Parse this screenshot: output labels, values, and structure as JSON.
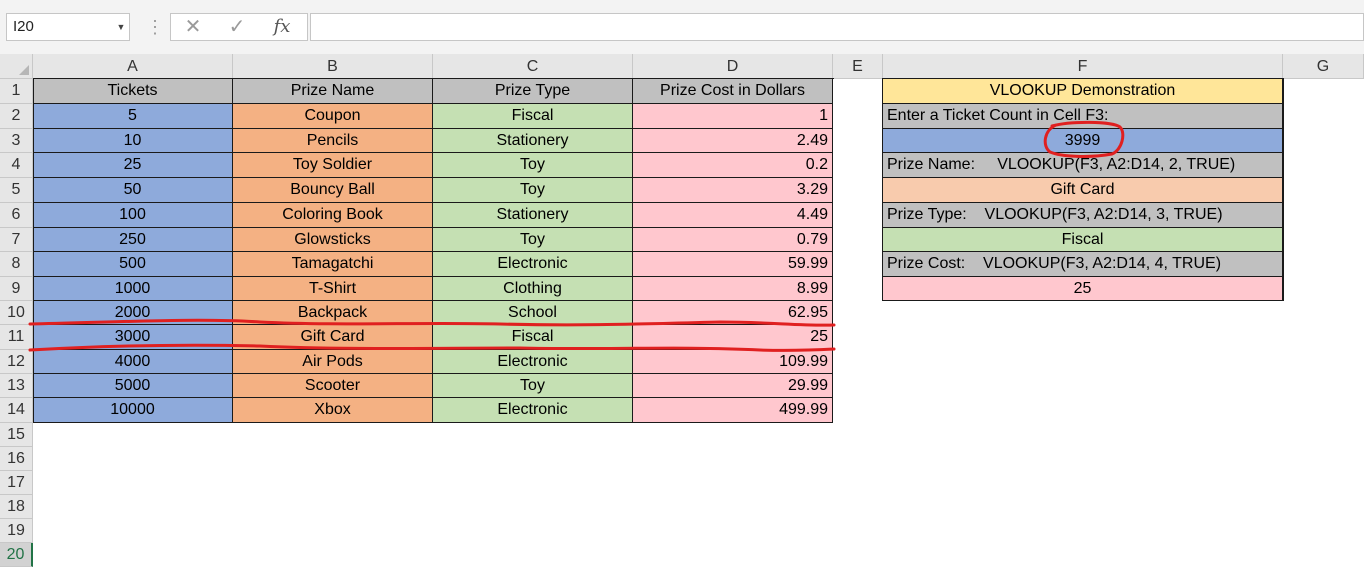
{
  "formula_bar": {
    "name_box": "I20",
    "cancel_icon": "✕",
    "enter_icon": "✓",
    "fx_label": "fx",
    "formula_value": ""
  },
  "colors": {
    "tickets": "#8eaadb",
    "prize_name": "#f4b183",
    "prize_type": "#c5e0b3",
    "prize_cost": "#ffc7ce",
    "header": "#c0c0c0",
    "demo_title": "#ffe699",
    "input_cell": "#8eaadb",
    "result_name": "#f8cbad",
    "annotation_red": "#e02020"
  },
  "columns": [
    "A",
    "B",
    "C",
    "D",
    "E",
    "F",
    "G"
  ],
  "rows": [
    "1",
    "2",
    "3",
    "4",
    "5",
    "6",
    "7",
    "8",
    "9",
    "10",
    "11",
    "12",
    "13",
    "14",
    "15",
    "16",
    "17",
    "18",
    "19",
    "20"
  ],
  "selected_row": "20",
  "table": {
    "headers": [
      "Tickets",
      "Prize Name",
      "Prize Type",
      "Prize Cost in Dollars"
    ],
    "rows": [
      [
        "5",
        "Coupon",
        "Fiscal",
        "1"
      ],
      [
        "10",
        "Pencils",
        "Stationery",
        "2.49"
      ],
      [
        "25",
        "Toy Soldier",
        "Toy",
        "0.2"
      ],
      [
        "50",
        "Bouncy Ball",
        "Toy",
        "3.29"
      ],
      [
        "100",
        "Coloring Book",
        "Stationery",
        "4.49"
      ],
      [
        "250",
        "Glowsticks",
        "Toy",
        "0.79"
      ],
      [
        "500",
        "Tamagatchi",
        "Electronic",
        "59.99"
      ],
      [
        "1000",
        "T-Shirt",
        "Clothing",
        "8.99"
      ],
      [
        "2000",
        "Backpack",
        "School",
        "62.95"
      ],
      [
        "3000",
        "Gift Card",
        "Fiscal",
        "25"
      ],
      [
        "4000",
        "Air Pods",
        "Electronic",
        "109.99"
      ],
      [
        "5000",
        "Scooter",
        "Toy",
        "29.99"
      ],
      [
        "10000",
        "Xbox",
        "Electronic",
        "499.99"
      ]
    ]
  },
  "demo": {
    "title": "VLOOKUP Demonstration",
    "prompt": "Enter a Ticket Count in Cell F3:",
    "input_value": "3999",
    "name_label": "Prize Name:     VLOOKUP(F3, A2:D14, 2, TRUE)",
    "name_result": "Gift Card",
    "type_label": "Prize Type:    VLOOKUP(F3, A2:D14, 3, TRUE)",
    "type_result": "Fiscal",
    "cost_label": "Prize Cost:    VLOOKUP(F3, A2:D14, 4, TRUE)",
    "cost_result": "25"
  }
}
